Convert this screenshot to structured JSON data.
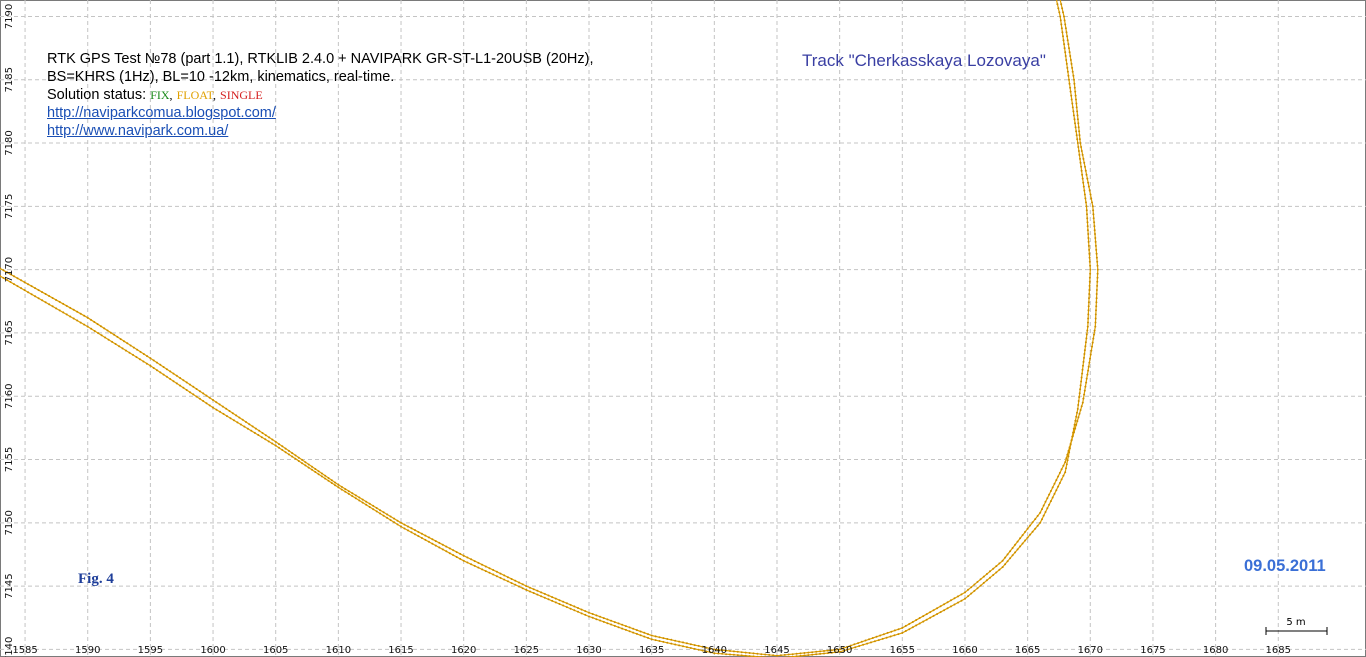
{
  "chart_data": {
    "type": "scatter",
    "xlim": [
      1583,
      1692
    ],
    "ylim": [
      7139.4,
      7191.3
    ],
    "x_ticks": [
      1585,
      1590,
      1595,
      1600,
      1605,
      1610,
      1615,
      1620,
      1625,
      1630,
      1635,
      1640,
      1645,
      1650,
      1655,
      1660,
      1665,
      1670,
      1675,
      1680,
      1685
    ],
    "y_ticks": [
      7140,
      7145,
      7150,
      7155,
      7160,
      7165,
      7170,
      7175,
      7180,
      7185,
      7190
    ],
    "grid": true,
    "series": [
      {
        "color": "#e0a000",
        "points": [
          [
            1583.0,
            7170.1
          ],
          [
            1590,
            7166.2
          ],
          [
            1595,
            7163.0
          ],
          [
            1600,
            7159.7
          ],
          [
            1605,
            7156.4
          ],
          [
            1610,
            7153.0
          ],
          [
            1615,
            7150.0
          ],
          [
            1620,
            7147.4
          ],
          [
            1625,
            7145.0
          ],
          [
            1630,
            7142.9
          ],
          [
            1635,
            7141.1
          ],
          [
            1640,
            7140.0
          ],
          [
            1645,
            7139.5
          ],
          [
            1650,
            7140.0
          ],
          [
            1655,
            7141.7
          ],
          [
            1660,
            7144.5
          ],
          [
            1663,
            7147.0
          ],
          [
            1666,
            7150.8
          ],
          [
            1668,
            7154.8
          ],
          [
            1669.4,
            7159.5
          ],
          [
            1670.4,
            7165.5
          ],
          [
            1670.6,
            7170.0
          ],
          [
            1670.2,
            7175.0
          ],
          [
            1669.2,
            7180.0
          ],
          [
            1668.7,
            7185.0
          ],
          [
            1667.9,
            7190.0
          ],
          [
            1667.6,
            7191.3
          ]
        ]
      },
      {
        "color": "#e0a000",
        "points": [
          [
            1583.0,
            7169.5
          ],
          [
            1590,
            7165.5
          ],
          [
            1595,
            7162.4
          ],
          [
            1600,
            7159.1
          ],
          [
            1605,
            7156.1
          ],
          [
            1610,
            7152.8
          ],
          [
            1615,
            7149.7
          ],
          [
            1620,
            7147.0
          ],
          [
            1625,
            7144.7
          ],
          [
            1630,
            7142.6
          ],
          [
            1635,
            7140.8
          ],
          [
            1640,
            7139.7
          ],
          [
            1645,
            7139.3
          ],
          [
            1650,
            7139.8
          ],
          [
            1655,
            7141.3
          ],
          [
            1660,
            7144.0
          ],
          [
            1663,
            7146.5
          ],
          [
            1666,
            7150.0
          ],
          [
            1668,
            7154.0
          ],
          [
            1669.0,
            7159.0
          ],
          [
            1669.8,
            7165.5
          ],
          [
            1670.0,
            7170.0
          ],
          [
            1669.7,
            7175.0
          ],
          [
            1669.0,
            7180.0
          ],
          [
            1668.3,
            7185.0
          ],
          [
            1667.6,
            7190.0
          ],
          [
            1667.3,
            7191.3
          ]
        ]
      }
    ],
    "scale_bar": {
      "length_m": 5,
      "label": "5 m"
    }
  },
  "info": {
    "line1": "RTK GPS Test №78 (part 1.1), RTKLIB 2.4.0 + NAVIPARK GR-ST-L1-20USB (20Hz),",
    "line2": "BS=KHRS (1Hz), BL=10 -12km, kinematics, real-time.",
    "status_label": "Solution status:",
    "status_fix": "FIX",
    "status_float": "FLOAT",
    "status_single": "SINGLE",
    "sep": ",",
    "link1": "http://naviparkcomua.blogspot.com/",
    "link2": "http://www.navipark.com.ua/"
  },
  "status_colors": {
    "fix": "#1a8a1a",
    "float": "#e0a000",
    "single": "#d42020"
  },
  "track_title": "Track \"Cherkasskaya Lozovaya\"",
  "fig_label": "Fig. 4",
  "date": "09.05.2011"
}
